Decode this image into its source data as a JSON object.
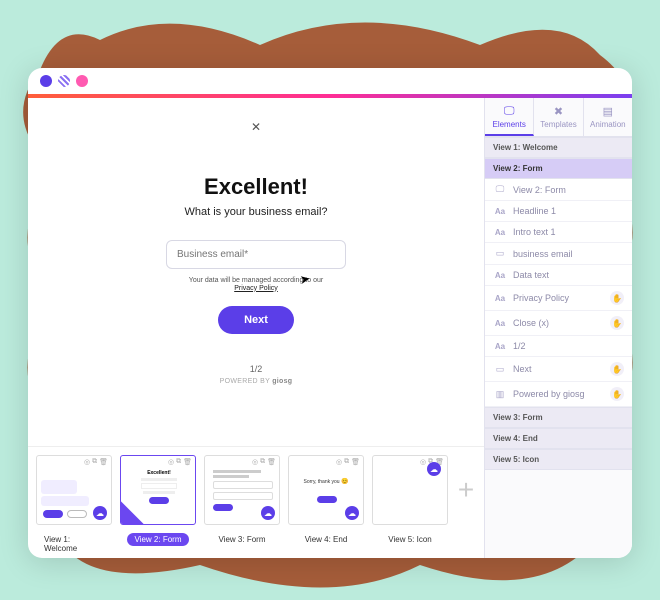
{
  "canvas": {
    "close_symbol": "✕",
    "headline": "Excellent!",
    "intro": "What is your business email?",
    "email_placeholder": "Business email*",
    "data_text": "Your data will be managed according to our",
    "privacy_label": "Privacy Policy",
    "next_label": "Next",
    "page_indicator": "1/2",
    "powered_prefix": "POWERED BY ",
    "powered_brand": "giosg"
  },
  "thumbs": [
    {
      "label": "View 1: Welcome",
      "active": false
    },
    {
      "label": "View 2: Form",
      "active": true
    },
    {
      "label": "View 3: Form",
      "active": false
    },
    {
      "label": "View 4: End",
      "active": false
    },
    {
      "label": "View 5: Icon",
      "active": false
    }
  ],
  "sidebar": {
    "tabs": [
      {
        "label": "Elements",
        "active": true
      },
      {
        "label": "Templates",
        "active": false
      },
      {
        "label": "Animation",
        "active": false
      }
    ],
    "sections": [
      {
        "title": "View 1: Welcome",
        "active": false,
        "layers": []
      },
      {
        "title": "View 2: Form",
        "active": true,
        "layers": [
          {
            "icon": "view",
            "name": "View 2: Form",
            "action": false
          },
          {
            "icon": "Aa",
            "name": "Headline 1",
            "action": false
          },
          {
            "icon": "Aa",
            "name": "Intro text 1",
            "action": false
          },
          {
            "icon": "input",
            "name": "business email",
            "action": false
          },
          {
            "icon": "Aa",
            "name": "Data text",
            "action": false
          },
          {
            "icon": "Aa",
            "name": "Privacy Policy",
            "action": true
          },
          {
            "icon": "Aa",
            "name": "Close (x)",
            "action": true
          },
          {
            "icon": "Aa",
            "name": "1/2",
            "action": false
          },
          {
            "icon": "button",
            "name": "Next",
            "action": true
          },
          {
            "icon": "widget",
            "name": "Powered by giosg",
            "action": true
          }
        ]
      },
      {
        "title": "View 3: Form",
        "active": false,
        "layers": []
      },
      {
        "title": "View 4: End",
        "active": false,
        "layers": []
      },
      {
        "title": "View 5: Icon",
        "active": false,
        "layers": []
      }
    ]
  }
}
